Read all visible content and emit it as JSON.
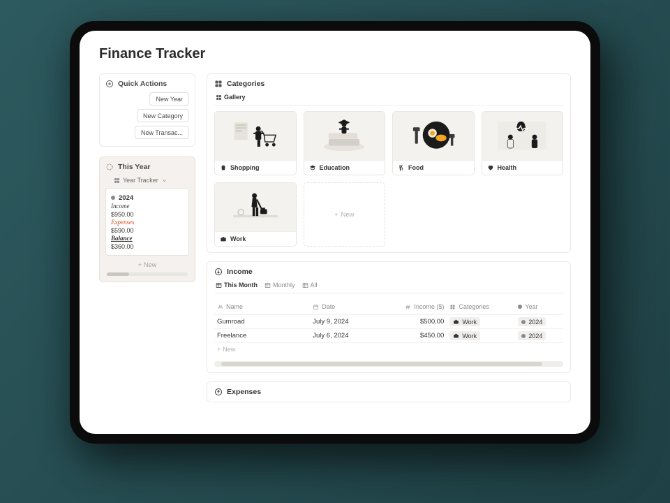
{
  "title": "Finance Tracker",
  "sidebar": {
    "quick_actions": {
      "title": "Quick Actions",
      "buttons": [
        "New Year",
        "New Category",
        "New Transac..."
      ]
    },
    "this_year": {
      "title": "This Year",
      "tracker_label": "Year Tracker",
      "card": {
        "year": "2024",
        "income_label": "Income",
        "income_value": "$950.00",
        "expenses_label": "Expenses",
        "expenses_value": "$590.00",
        "balance_label": "Balance",
        "balance_value": "$360.00"
      },
      "new_label": "New"
    }
  },
  "categories": {
    "title": "Categories",
    "view_tab": "Gallery",
    "items": [
      {
        "label": "Shopping",
        "icon": "shopping-bag"
      },
      {
        "label": "Education",
        "icon": "graduation"
      },
      {
        "label": "Food",
        "icon": "food"
      },
      {
        "label": "Health",
        "icon": "health"
      },
      {
        "label": "Work",
        "icon": "briefcase"
      }
    ],
    "new_label": "New"
  },
  "income": {
    "title": "Income",
    "tabs": [
      "This Month",
      "Monthly",
      "All"
    ],
    "active_tab": 0,
    "columns": {
      "name": "Name",
      "date": "Date",
      "amount": "Income ($)",
      "categories": "Categories",
      "year": "Year"
    },
    "rows": [
      {
        "name": "Gumroad",
        "date": "July 9, 2024",
        "amount": "$500.00",
        "category": "Work",
        "year": "2024"
      },
      {
        "name": "Freelance",
        "date": "July 6, 2024",
        "amount": "$450.00",
        "category": "Work",
        "year": "2024"
      }
    ],
    "new_label": "New"
  },
  "expenses": {
    "title": "Expenses"
  }
}
